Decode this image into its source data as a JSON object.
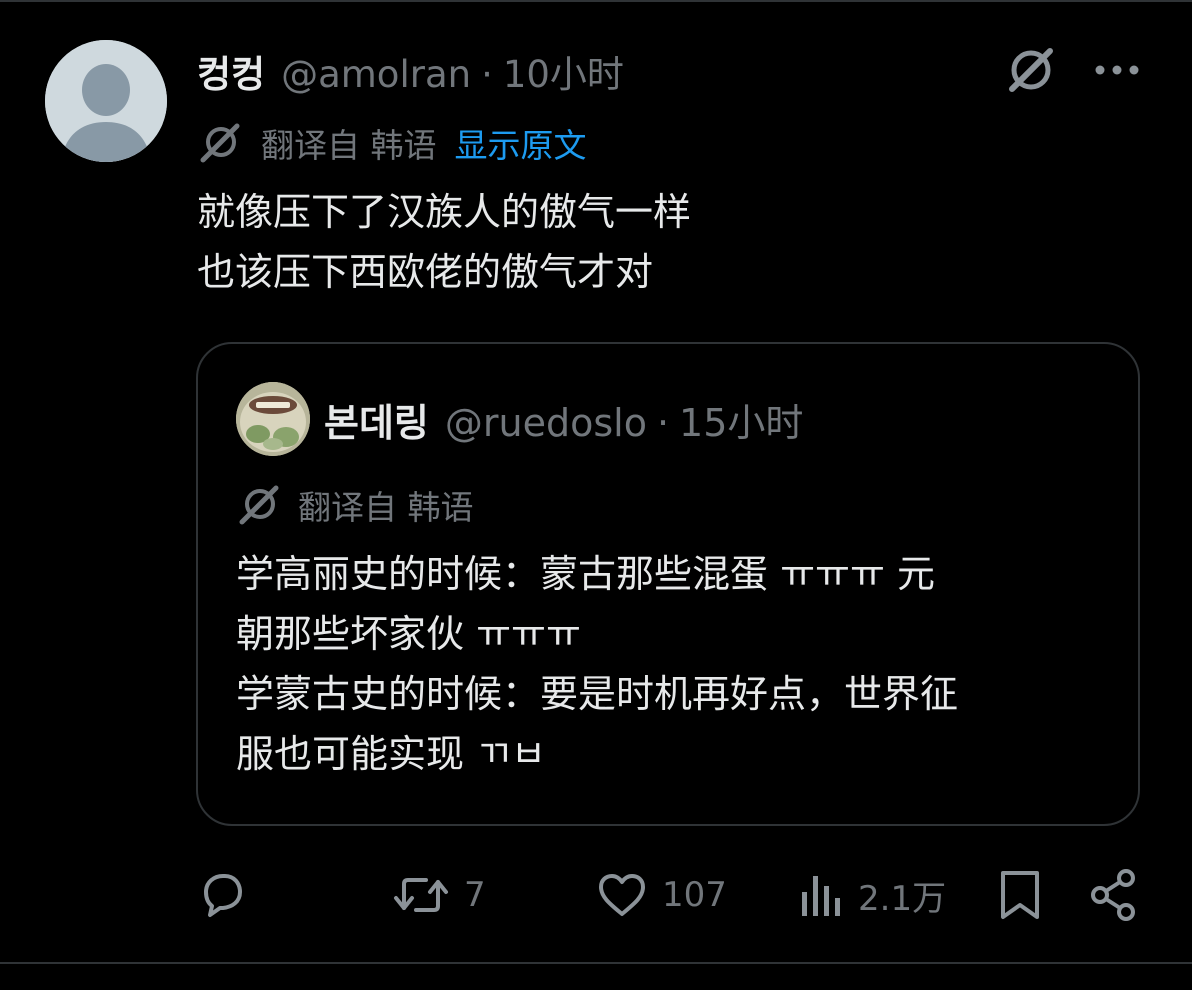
{
  "post": {
    "author": {
      "display_name": "컹컹",
      "handle": "@amolran",
      "separator": "·",
      "time": "10小时"
    },
    "translation": {
      "label": "翻译自 韩语",
      "link": "显示原文"
    },
    "text_lines": [
      "就像压下了汉族人的傲气一样",
      "也该压下西欧佬的傲气才对"
    ]
  },
  "quote": {
    "author": {
      "display_name": "본데링",
      "handle": "@ruedoslo",
      "separator": "·",
      "time": "15小时"
    },
    "translation": {
      "label": "翻译自 韩语"
    },
    "text_lines": [
      "学高丽史的时候：蒙古那些混蛋 ㅠㅠㅠ 元",
      "朝那些坏家伙 ㅠㅠㅠ",
      "学蒙古史的时候：要是时机再好点，世界征",
      "服也可能实现 ㄲㅂ"
    ]
  },
  "actions": {
    "reply": {
      "icon": "reply-icon",
      "count": ""
    },
    "repost": {
      "icon": "repost-icon",
      "count": "7"
    },
    "like": {
      "icon": "heart-icon",
      "count": "107"
    },
    "views": {
      "icon": "views-icon",
      "count": "2.1万"
    },
    "bookmark": {
      "icon": "bookmark-icon"
    },
    "share": {
      "icon": "share-icon"
    }
  },
  "colors": {
    "background": "#000000",
    "text": "#e7e9ea",
    "muted": "#71767b",
    "link": "#1d9bf0",
    "border": "#2f3336"
  }
}
